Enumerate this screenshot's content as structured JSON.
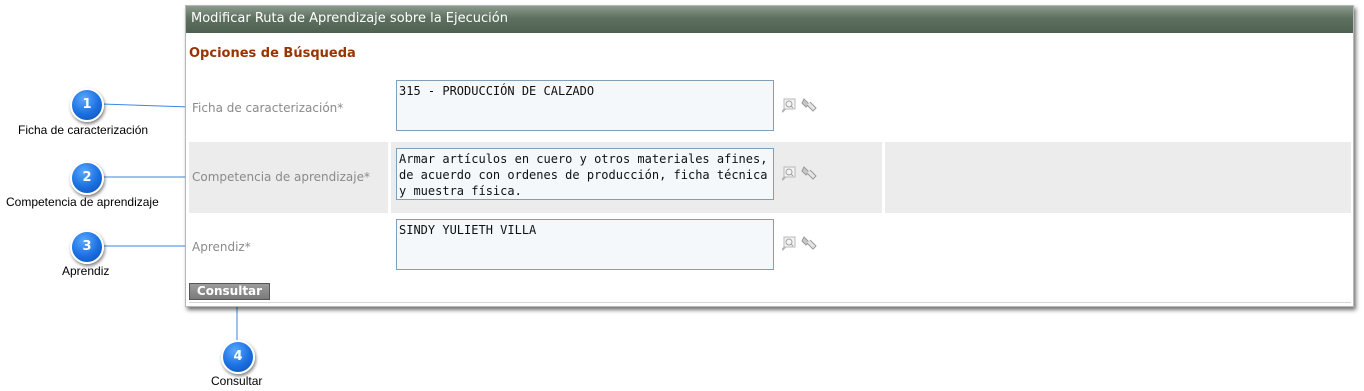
{
  "window": {
    "title": "Modificar Ruta de Aprendizaje sobre la Ejecución"
  },
  "form": {
    "section_title": "Opciones de Búsqueda",
    "fields": [
      {
        "label": "Ficha de caracterización*",
        "value": "315 - PRODUCCIÓN DE CALZADO"
      },
      {
        "label": "Competencia de aprendizaje*",
        "value": "Armar artículos en cuero y otros materiales afines, de acuerdo con ordenes de producción, ficha técnica y muestra física."
      },
      {
        "label": "Aprendiz*",
        "value": "SINDY YULIETH VILLA"
      }
    ],
    "submit_label": "Consultar"
  },
  "callouts": [
    {
      "number": "1",
      "text": "Ficha de caracterización"
    },
    {
      "number": "2",
      "text": "Competencia de aprendizaje"
    },
    {
      "number": "3",
      "text": "Aprendiz"
    },
    {
      "number": "4",
      "text": "Consultar"
    }
  ],
  "colors": {
    "accent": "#1a6fe0",
    "title_bar": "#5e7060",
    "section_title": "#993300",
    "field_border": "#7fa0b8"
  },
  "icons": {
    "search": "magnifier-icon",
    "clear": "eraser-icon"
  }
}
